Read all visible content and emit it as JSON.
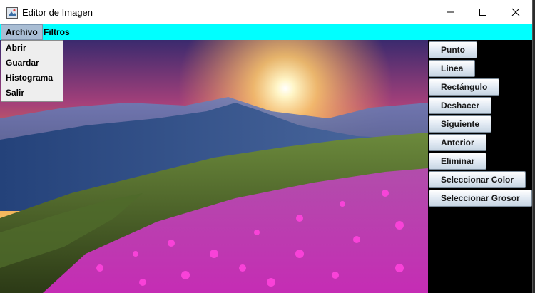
{
  "window": {
    "title": "Editor de Imagen"
  },
  "menubar": {
    "items": [
      "Archivo",
      "Filtros"
    ],
    "active": "Archivo"
  },
  "archivo_menu": {
    "items": [
      "Abrir",
      "Guardar",
      "Histograma",
      "Salir"
    ]
  },
  "tools": {
    "buttons": [
      "Punto",
      "Linea",
      "Rectángulo",
      "Deshacer",
      "Siguiente",
      "Anterior",
      "Eliminar",
      "Seleccionar Color",
      "Seleccionar Grosor"
    ]
  },
  "colors": {
    "menubar": "#00ffff",
    "panel": "#000000",
    "menu_active": "#a9bdd4"
  }
}
